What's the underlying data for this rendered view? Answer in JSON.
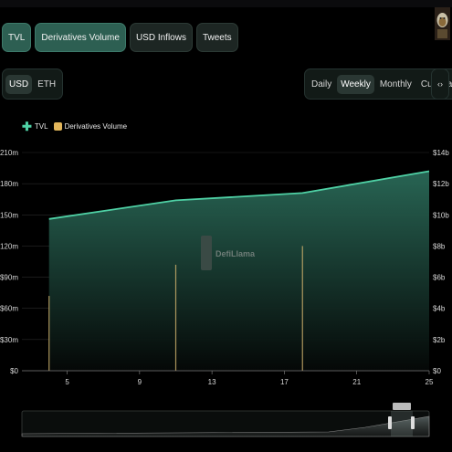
{
  "metric_tabs": [
    {
      "label": "TVL",
      "active": true
    },
    {
      "label": "Derivatives Volume",
      "active": true
    },
    {
      "label": "USD Inflows",
      "active": false
    },
    {
      "label": "Tweets",
      "active": false
    }
  ],
  "currency": {
    "options": [
      "USD",
      "ETH"
    ],
    "selected": "USD"
  },
  "period": {
    "options": [
      "Daily",
      "Weekly",
      "Monthly",
      "Cumulative"
    ],
    "selected": "Weekly"
  },
  "embed_label": "‹›",
  "watermark": "DefiLlama",
  "colors": {
    "accent": "#2d5f52",
    "tvl_line": "#4fd1a5",
    "tvl_fill_top": "#2a6a58",
    "volume_bar": "#c9ad6a",
    "background": "#000000"
  },
  "chart_data": {
    "type": "area",
    "series": [
      {
        "name": "TVL",
        "axis": "left",
        "x": [
          4,
          11,
          18,
          25
        ],
        "values": [
          146,
          164,
          171,
          192
        ]
      },
      {
        "name": "Derivatives Volume",
        "type": "bar",
        "axis": "right",
        "x": [
          4,
          11,
          18
        ],
        "values": [
          4.8,
          6.8,
          8.0
        ]
      }
    ],
    "x_ticks": [
      "5",
      "9",
      "13",
      "17",
      "21",
      "25"
    ],
    "x_tick_values": [
      5,
      9,
      13,
      17,
      21,
      25
    ],
    "xlim": [
      2.5,
      25
    ],
    "y_left_ticks": [
      "$0",
      "$30m",
      "$60m",
      "$90m",
      "$120m",
      "$150m",
      "$180m",
      "$210m"
    ],
    "y_left_values": [
      0,
      30,
      60,
      90,
      120,
      150,
      180,
      210
    ],
    "ylim_left": [
      0,
      210
    ],
    "y_right_ticks": [
      "$0",
      "$2b",
      "$4b",
      "$6b",
      "$8b",
      "$10b",
      "$12b",
      "$14b"
    ],
    "y_right_values": [
      0,
      2,
      4,
      6,
      8,
      10,
      12,
      14
    ],
    "ylim_right": [
      0,
      14
    ],
    "grid": true,
    "legend_position": "top-left"
  }
}
